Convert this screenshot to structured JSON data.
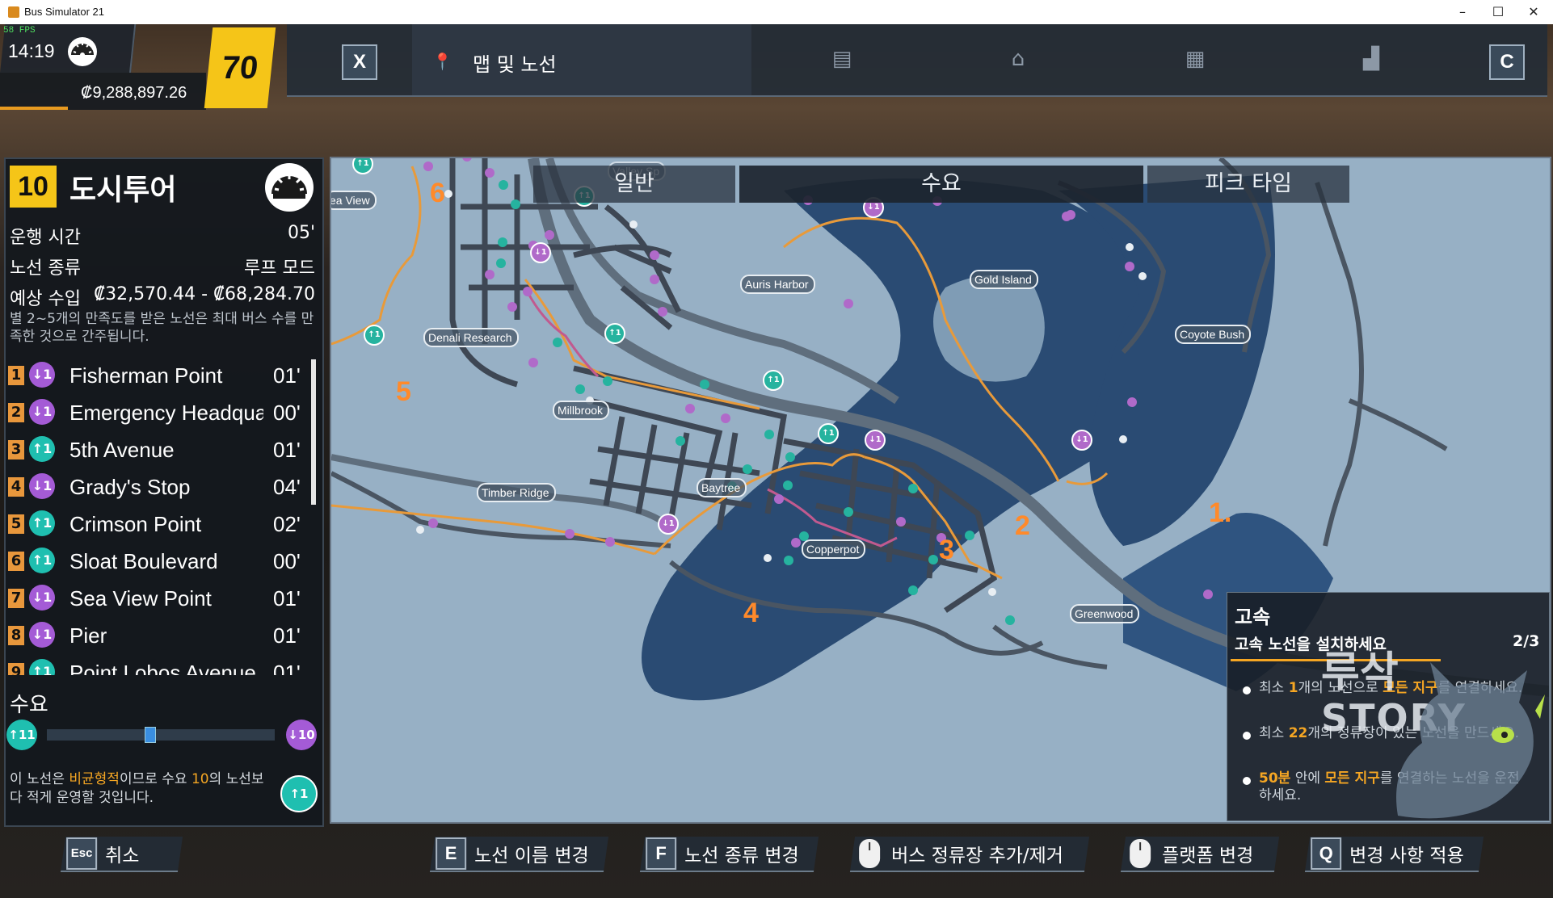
{
  "window": {
    "title": "Bus Simulator 21",
    "min": "–",
    "max": "☐",
    "close": "✕"
  },
  "hud": {
    "fps": "58 FPS",
    "time": "14:19",
    "money": "₡9,288,897.26",
    "level": "70",
    "money_progress": 0.33
  },
  "topbar": {
    "close_key": "X",
    "tab_label": "맵 및 노선",
    "right_key": "C",
    "icons": [
      "route-book-icon",
      "bus-depot-icon",
      "building-icon",
      "statistics-icon"
    ]
  },
  "route": {
    "number": "10",
    "name": "도시투어",
    "info": [
      {
        "label": "운행 시간",
        "value": "05'"
      },
      {
        "label": "노선 종류",
        "value": "루프 모드"
      },
      {
        "label": "예상 수입",
        "value": "₡32,570.44 - ₡68,284.70"
      }
    ],
    "note": "별 2~5개의 만족도를 받은 노선은 최대 버스 수를 만족한 것으로 간주됩니다.",
    "stops": [
      {
        "num": "1",
        "dir": "↓1",
        "color": "#a45bd6",
        "name": "Fisherman Point",
        "time": "01'"
      },
      {
        "num": "2",
        "dir": "↓1",
        "color": "#a45bd6",
        "name": "Emergency Headquarters",
        "time": "00'"
      },
      {
        "num": "3",
        "dir": "↑1",
        "color": "#1fbfb0",
        "name": "5th Avenue",
        "time": "01'"
      },
      {
        "num": "4",
        "dir": "↓1",
        "color": "#a45bd6",
        "name": "Grady's Stop",
        "time": "04'"
      },
      {
        "num": "5",
        "dir": "↑1",
        "color": "#1fbfb0",
        "name": "Crimson Point",
        "time": "02'"
      },
      {
        "num": "6",
        "dir": "↑1",
        "color": "#1fbfb0",
        "name": "Sloat Boulevard",
        "time": "00'"
      },
      {
        "num": "7",
        "dir": "↓1",
        "color": "#a45bd6",
        "name": "Sea View Point",
        "time": "01'"
      },
      {
        "num": "8",
        "dir": "↓1",
        "color": "#a45bd6",
        "name": "Pier",
        "time": "01'"
      },
      {
        "num": "9",
        "dir": "↑1",
        "color": "#1fbfb0",
        "name": "Point Lobos Avenue",
        "time": "01'"
      }
    ],
    "demand": {
      "label": "수요",
      "left": "↑11",
      "right": "↓10",
      "level": 0.45,
      "note_pre": "이 노선은 ",
      "note_hl": "비균형적",
      "note_mid": "이므로 수요 ",
      "note_hl2": "10",
      "note_post": "의 노선보다 적게 운영할 것입니다.",
      "badge": "↑1"
    }
  },
  "map": {
    "tabs": [
      "일반",
      "수요",
      "피크 타임"
    ],
    "active_tab": 1,
    "locations": [
      "ea View",
      "Valley Sp",
      "Auris Harbor",
      "Gold Island",
      "Denali Research",
      "Coyote Bush",
      "Millbrook",
      "Timber Ridge",
      "Baytree",
      "Copperpot",
      "Greenwood"
    ],
    "regions": [
      "1.",
      "2",
      "3",
      "4",
      "5",
      "6"
    ]
  },
  "mission": {
    "title": "고속",
    "subtitle": "고속 노선을 설치하세요",
    "count": "2/3",
    "tasks": [
      {
        "pre": "최소 ",
        "hl": "1",
        "mid": "개의 노선으로 ",
        "hl2": "모든 지구",
        "post": "를 연결하세요."
      },
      {
        "pre": "최소 ",
        "hl": "22",
        "mid": "개의 정류장이 있는 노선을 ",
        "hl2": "",
        "post": "만드세요."
      },
      {
        "pre": "",
        "hl": "50분",
        "mid": " 안에 ",
        "hl2": "모든 지구",
        "post": "를 연결하는 노선을 운전하세요."
      }
    ],
    "watermark_top": "루삭",
    "watermark_bottom": "STORY"
  },
  "bottom": [
    {
      "key": "Esc",
      "label": "취소"
    },
    {
      "key": "E",
      "label": "노선 이름 변경"
    },
    {
      "key": "F",
      "label": "노선 종류 변경"
    },
    {
      "key": "mouse-left",
      "label": "버스 정류장 추가/제거"
    },
    {
      "key": "mouse-right",
      "label": "플랫폼 변경"
    },
    {
      "key": "Q",
      "label": "변경 사항 적용"
    }
  ],
  "colors": {
    "accent": "#f5c518",
    "orange": "#ff8a2a",
    "purple": "#a45bd6",
    "teal": "#1fbfb0",
    "water": "#294a73",
    "land": "#94adc2"
  }
}
